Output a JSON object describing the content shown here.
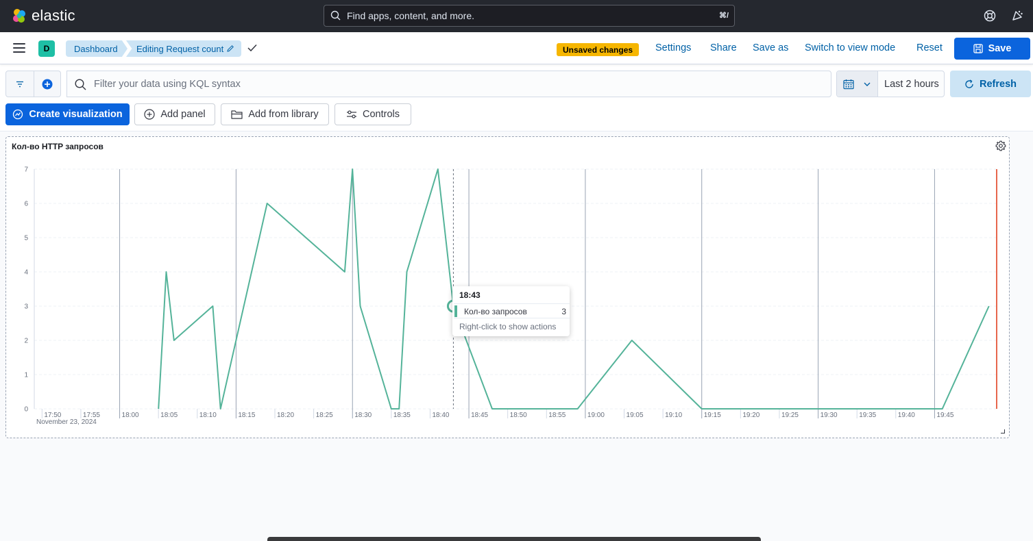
{
  "header": {
    "brand": "elastic",
    "search_placeholder": "Find apps, content, and more.",
    "search_shortcut": "⌘/"
  },
  "nav": {
    "space_initial": "D",
    "breadcrumbs": [
      "Dashboard",
      "Editing Request count"
    ],
    "unsaved_badge": "Unsaved changes",
    "links": [
      "Settings",
      "Share",
      "Save as",
      "Switch to view mode",
      "Reset"
    ],
    "save_label": "Save"
  },
  "query": {
    "kql_placeholder": "Filter your data using KQL syntax",
    "time_range": "Last 2 hours",
    "refresh_label": "Refresh"
  },
  "toolbar": {
    "create_visualization": "Create visualization",
    "add_panel": "Add panel",
    "add_from_library": "Add from library",
    "controls": "Controls"
  },
  "panel": {
    "title": "Кол-во HTTP запросов"
  },
  "chart_data": {
    "type": "line",
    "series": [
      {
        "name": "Кол-во запросов",
        "color": "#54b399",
        "points": [
          [
            "18:05",
            0
          ],
          [
            "18:06",
            4
          ],
          [
            "18:07",
            2
          ],
          [
            "18:12",
            3
          ],
          [
            "18:13",
            0
          ],
          [
            "18:19",
            6
          ],
          [
            "18:29",
            4
          ],
          [
            "18:30",
            7
          ],
          [
            "18:31",
            3
          ],
          [
            "18:35",
            0
          ],
          [
            "18:36",
            0
          ],
          [
            "18:37",
            4
          ],
          [
            "18:41",
            7
          ],
          [
            "18:43",
            3
          ],
          [
            "18:48",
            0
          ],
          [
            "18:59",
            0
          ],
          [
            "19:06",
            2
          ],
          [
            "19:15",
            0
          ],
          [
            "19:46",
            0
          ],
          [
            "19:52",
            3
          ]
        ]
      }
    ],
    "x_ticks": [
      "17:50",
      "17:55",
      "18:00",
      "18:05",
      "18:10",
      "18:15",
      "18:20",
      "18:25",
      "18:30",
      "18:35",
      "18:40",
      "18:45",
      "18:50",
      "18:55",
      "19:00",
      "19:05",
      "19:10",
      "19:15",
      "19:20",
      "19:25",
      "19:30",
      "19:35",
      "19:40",
      "19:45"
    ],
    "x_date_label": "November 23, 2024",
    "y_ticks": [
      0,
      1,
      2,
      3,
      4,
      5,
      6,
      7
    ],
    "ylim": [
      0,
      7
    ],
    "xlim": [
      "17:49",
      "19:53"
    ],
    "grid": true,
    "now_marker": "19:53",
    "hover": "18:43"
  },
  "tooltip": {
    "time": "18:43",
    "series_name": "Кол-во запросов",
    "value": "3",
    "footer": "Right-click to show actions"
  }
}
